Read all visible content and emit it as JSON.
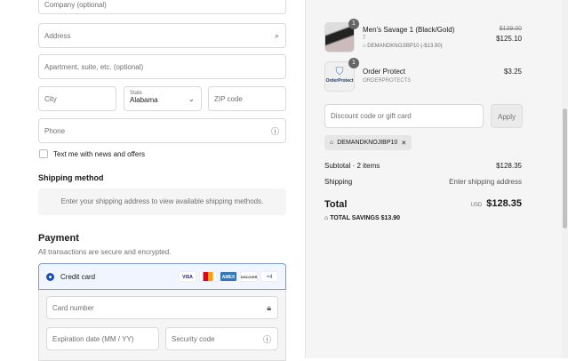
{
  "form": {
    "company_placeholder": "Company (optional)",
    "address_placeholder": "Address",
    "apartment_placeholder": "Apartment, suite, etc. (optional)",
    "city_placeholder": "City",
    "state_label": "State",
    "state_value": "Alabama",
    "zip_placeholder": "ZIP code",
    "phone_placeholder": "Phone",
    "news_checkbox_label": "Text me with news and offers"
  },
  "shipping": {
    "title": "Shipping method",
    "message": "Enter your shipping address to view available shipping methods."
  },
  "payment": {
    "title": "Payment",
    "subtitle": "All transactions are secure and encrypted.",
    "method_label": "Credit card",
    "cards": [
      "VISA",
      "MC",
      "AMEX",
      "DISCOVER"
    ],
    "more_cards": "+4",
    "card_number_placeholder": "Card number",
    "expiration_placeholder": "Expiration date (MM / YY)",
    "security_code_placeholder": "Security code"
  },
  "summary": {
    "items": [
      {
        "name": "Men's Savage 1 (Black/Gold)",
        "variant": "7",
        "discount": "DEMANDKNOJIBP10 (-$13.90)",
        "original_price": "$139.00",
        "price": "$125.10",
        "quantity": "1"
      },
      {
        "name": "Order Protect",
        "variant": "ORDERPROTECT3",
        "price": "$3.25",
        "quantity": "1",
        "logo_text": "OrderProtect"
      }
    ],
    "discount_placeholder": "Discount code or gift card",
    "apply_label": "Apply",
    "applied_code": "DEMANDKNOJIBP10",
    "subtotal_label": "Subtotal · 2 items",
    "subtotal_value": "$128.35",
    "shipping_label": "Shipping",
    "shipping_value": "Enter shipping address",
    "total_label": "Total",
    "currency": "USD",
    "total_value": "$128.35",
    "savings_label": "TOTAL SAVINGS",
    "savings_value": "$13.90"
  }
}
